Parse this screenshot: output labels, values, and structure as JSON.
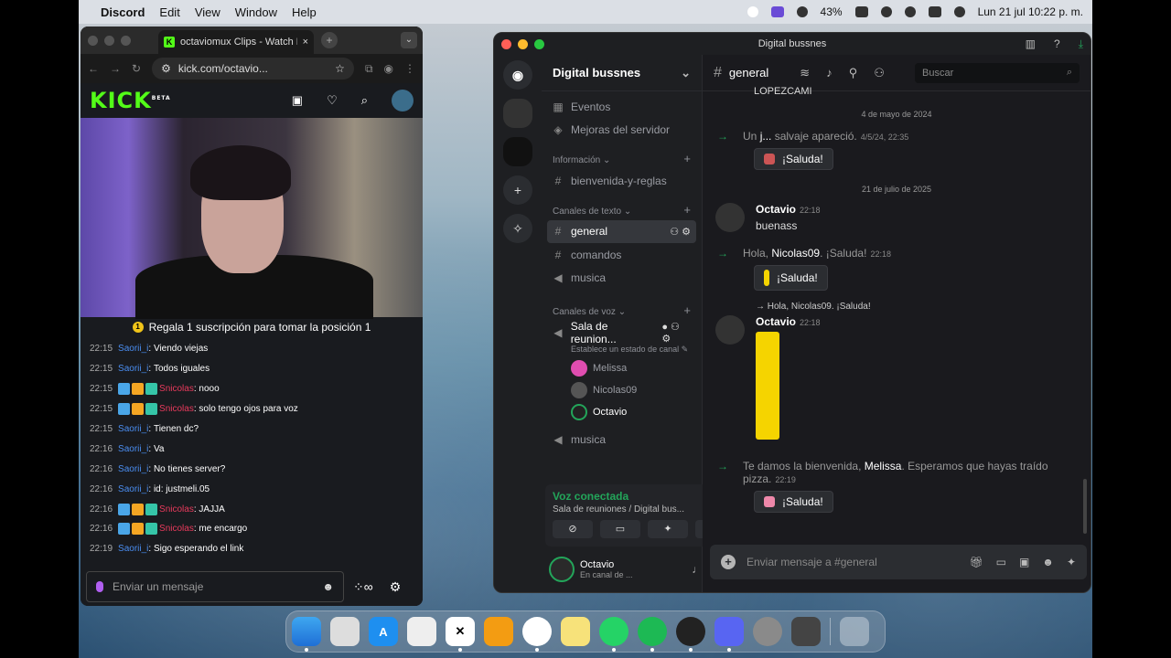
{
  "menubar": {
    "app": "Discord",
    "menus": [
      "Edit",
      "View",
      "Window",
      "Help"
    ],
    "battery": "43%",
    "datetime": "Lun 21 jul  10:22 p. m."
  },
  "browser": {
    "tab_title": "octaviomux Clips - Watch Liv",
    "url": "kick.com/octavio...",
    "kick_logo": "KICK",
    "kick_beta": "BETA",
    "sub_banner": "Regala 1 suscripción para tomar la posición 1",
    "chat": [
      {
        "time": "22:15",
        "user": "Saorii_i",
        "color": "blue",
        "badges": false,
        "text": "Viendo viejas"
      },
      {
        "time": "22:15",
        "user": "Saorii_i",
        "color": "blue",
        "badges": false,
        "text": "Todos iguales"
      },
      {
        "time": "22:15",
        "user": "Snicolas",
        "color": "red",
        "badges": true,
        "text": "nooo"
      },
      {
        "time": "22:15",
        "user": "Snicolas",
        "color": "red",
        "badges": true,
        "text": "solo tengo ojos para voz"
      },
      {
        "time": "22:15",
        "user": "Saorii_i",
        "color": "blue",
        "badges": false,
        "text": "Tienen dc?"
      },
      {
        "time": "22:16",
        "user": "Saorii_i",
        "color": "blue",
        "badges": false,
        "text": "Va"
      },
      {
        "time": "22:16",
        "user": "Saorii_i",
        "color": "blue",
        "badges": false,
        "text": "No tienes server?"
      },
      {
        "time": "22:16",
        "user": "Saorii_i",
        "color": "blue",
        "badges": false,
        "text": "id: justmeli.05"
      },
      {
        "time": "22:16",
        "user": "Snicolas",
        "color": "red",
        "badges": true,
        "text": "JAJJA"
      },
      {
        "time": "22:16",
        "user": "Snicolas",
        "color": "red",
        "badges": true,
        "text": "me encargo"
      },
      {
        "time": "22:19",
        "user": "Saorii_i",
        "color": "blue",
        "badges": false,
        "text": "Sigo esperando el link"
      }
    ],
    "chat_placeholder": "Enviar un mensaje"
  },
  "discord": {
    "window_title": "Digital bussnes",
    "server_name": "Digital bussnes",
    "top_items": [
      {
        "icon": "calendar-icon",
        "label": "Eventos"
      },
      {
        "icon": "boost-icon",
        "label": "Mejoras del servidor"
      }
    ],
    "cat_info": "Información",
    "info_channel": "bienvenida-y-reglas",
    "cat_text": "Canales de texto",
    "text_channels": [
      "general",
      "comandos"
    ],
    "text_voice_channel": "musica",
    "cat_voice": "Canales de voz",
    "voice_channel": "Sala de reunion...",
    "voice_status": "Establece un estado de canal",
    "voice_users": [
      "Melissa",
      "Nicolas09",
      "Octavio"
    ],
    "voice_channel2": "musica",
    "vc_title": "Voz conectada",
    "vc_sub": "Sala de reuniones / Digital bus...",
    "user_name": "Octavio",
    "user_status": "En canal de ...",
    "channel": "general",
    "search_placeholder": "Buscar",
    "prev_text": "LOPEZCAMI",
    "date1": "4 de mayo de 2024",
    "sys1_pre": "Un ",
    "sys1_user": "j...",
    "sys1_post": " salvaje apareció.",
    "sys1_ts": "4/5/24, 22:35",
    "saluda": "¡Saluda!",
    "date2": "21 de julio de 2025",
    "msg1_name": "Octavio",
    "msg1_ts": "22:18",
    "msg1_text": "buenass",
    "sys2_pre": "Hola, ",
    "sys2_user": "Nicolas09",
    "sys2_post": ". ¡Saluda!",
    "sys2_ts": "22:18",
    "reply_line": "→ Hola, Nicolas09. ¡Saluda!",
    "msg2_name": "Octavio",
    "msg2_ts": "22:18",
    "sys3_pre": "Te damos la bienvenida, ",
    "sys3_user": "Melissa",
    "sys3_post": ". Esperamos que hayas traído pizza.",
    "sys3_ts": "22:19",
    "composer_placeholder": "Enviar mensaje a #general"
  },
  "dock": [
    "Finder",
    "Launchpad",
    "App Store",
    "Pencil",
    "CapCut",
    "Pages",
    "Chrome",
    "Notes",
    "WhatsApp",
    "Spotify",
    "OBS",
    "Discord",
    "System Settings",
    "Calculator",
    "Trash"
  ]
}
